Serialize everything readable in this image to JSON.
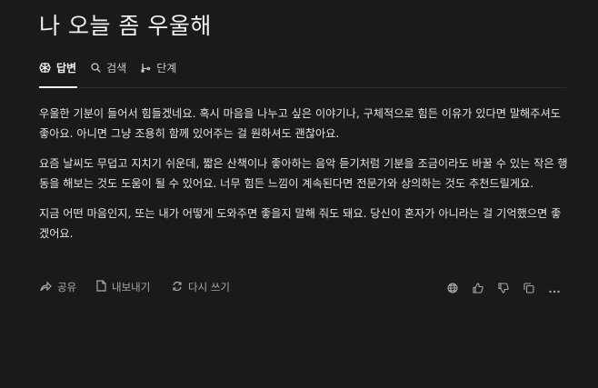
{
  "title": "나 오늘 좀 우울해",
  "tabs": [
    {
      "label": "답변",
      "icon": "answer-icon",
      "active": true
    },
    {
      "label": "검색",
      "icon": "search-icon",
      "active": false
    },
    {
      "label": "단계",
      "icon": "steps-icon",
      "active": false
    }
  ],
  "answer": {
    "paragraphs": [
      "우울한 기분이 들어서 힘들겠네요. 혹시 마음을 나누고 싶은 이야기나, 구체적으로 힘든 이유가 있다면 말해주셔도 좋아요. 아니면 그냥 조용히 함께 있어주는 걸 원하셔도 괜찮아요.",
      "요즘 날씨도 무덥고 지치기 쉬운데, 짧은 산책이나 좋아하는 음악 듣기처럼 기분을 조금이라도 바꿀 수 있는 작은 행동을 해보는 것도 도움이 될 수 있어요. 너무 힘든 느낌이 계속된다면 전문가와 상의하는 것도 추천드릴게요.",
      "지금 어떤 마음인지, 또는 내가 어떻게 도와주면 좋을지 말해 줘도 돼요. 당신이 혼자가 아니라는 걸 기억했으면 좋겠어요."
    ]
  },
  "actions": {
    "share": "공유",
    "export": "내보내기",
    "rewrite": "다시 쓰기"
  },
  "icon_buttons": [
    "globe-icon",
    "thumbs-up-icon",
    "thumbs-down-icon",
    "copy-icon",
    "more-icon"
  ],
  "colors": {
    "background": "#191a1a",
    "text": "#e8e8e6",
    "muted": "#a9aaa7"
  }
}
